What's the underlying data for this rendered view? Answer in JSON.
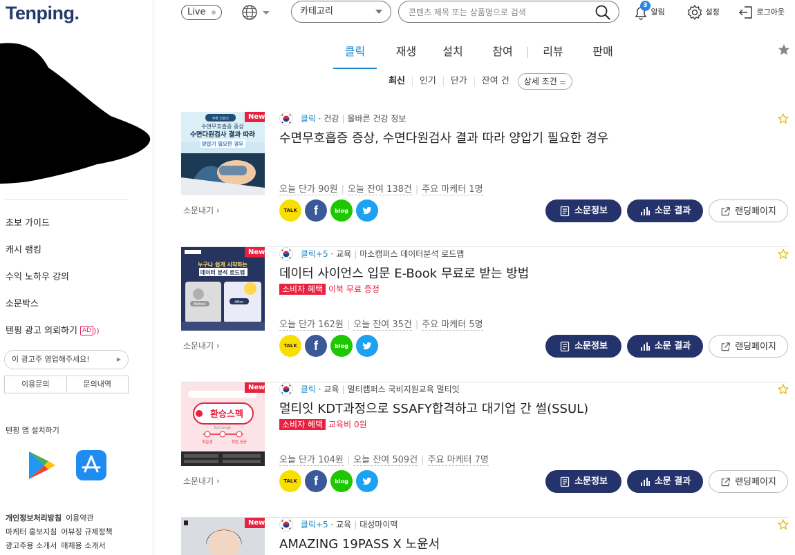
{
  "brand": {
    "logo": "Tenping."
  },
  "header": {
    "live": "Live",
    "category": "카테고리",
    "search_placeholder": "콘텐츠 제목 또는 상품명으로 검색",
    "bell_count": "3",
    "alarm": "알림",
    "settings": "설정",
    "logout": "로그아웃"
  },
  "tabs": [
    "클릭",
    "재생",
    "설치",
    "참여",
    "리뷰",
    "판매"
  ],
  "subfilters": [
    "최신",
    "인기",
    "단가",
    "잔여 건"
  ],
  "detail_filter": "상세 조건",
  "sidebar": {
    "menu": [
      "초보 가이드",
      "캐시 랭킹",
      "수익 노하우 강의",
      "소문박스",
      "텐핑 광고 의뢰하기"
    ],
    "ad_badge": "AD",
    "ad_pill": "이 광고주 영업해주세요!",
    "help": [
      "이용문의",
      "문의내역"
    ],
    "app_install": "텐핑 앱 설치하기",
    "footer": [
      [
        "개인정보처리방침",
        "이용약관"
      ],
      [
        "마케터 홍보지침",
        "어뷰징 규제정책"
      ],
      [
        "광고주용 소개서",
        "매체용 소개서"
      ]
    ]
  },
  "card_common": {
    "new": "New",
    "share": "소문내기",
    "info_btn": "소문정보",
    "result_btn": "소문 결과",
    "landing_btn": "랜딩페이지",
    "talk": "TALK",
    "blog": "blog",
    "fb": "f"
  },
  "cards": [
    {
      "type": "클릭",
      "category": "건강",
      "advertiser": "올바른 건강 정보",
      "title": "수면무호흡증 증상, 수면다원검사 결과 따라 양압기 필요한 경우",
      "price": "오늘 단가 90원",
      "remaining": "오늘 잔여 138건",
      "marketers": "주요 마케터 1명",
      "thumb": {
        "line1": "수면무호흡증 증상",
        "line2": "수면다원검사 결과 따라",
        "line3": "양압기 필요한 경우",
        "top": "수면 건강스"
      }
    },
    {
      "type": "클릭+5",
      "category": "교육",
      "advertiser": "마소캠퍼스 데이터분석 로드맵",
      "title": "데이터 사이언스 입문 E-Book 무료로 받는 방법",
      "benefit_tag": "소비자 혜택",
      "benefit": "이북 무료 증정",
      "price": "오늘 단가 162원",
      "remaining": "오늘 잔여 35건",
      "marketers": "주요 마케터 5명",
      "thumb": {
        "line1": "누구나 쉽게 시작하는",
        "line2": "데이터 분석 로드맵",
        "before": "Before",
        "after": "After"
      }
    },
    {
      "type": "클릭",
      "category": "교육",
      "advertiser": "멀티캠퍼스 국비지원교육 멀티잇",
      "title": "멀티잇 KDT과정으로 SSAFY합격하고 대기업 간 썰(SSUL)",
      "benefit_tag": "소비자 혜택",
      "benefit": "교육비 0원",
      "price": "오늘 단가 104원",
      "remaining": "오늘 잔여 509건",
      "marketers": "주요 마케터 7명",
      "thumb": {
        "line1": "환승스펙",
        "line2": "Exchange",
        "l1": "취준생",
        "l2": "취업 성공"
      }
    },
    {
      "type": "클릭+5",
      "category": "교육",
      "advertiser": "대성마이맥",
      "title": "AMAZING 19PASS X 노윤서"
    }
  ],
  "colors": {
    "accent": "#1c8ac8",
    "navy": "#24336b",
    "red": "#e8213e"
  }
}
